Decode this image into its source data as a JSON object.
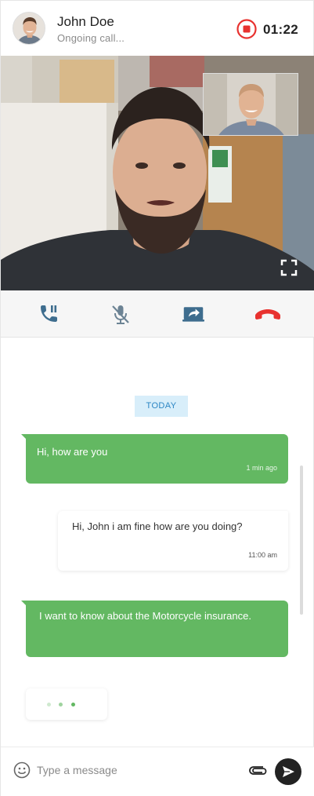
{
  "header": {
    "contact_name": "John Doe",
    "status": "Ongoing call...",
    "timer": "01:22",
    "record_icon": "record-stop-icon"
  },
  "video": {
    "fullscreen_icon": "fullscreen-icon"
  },
  "controls": {
    "items": [
      {
        "name": "hold-call",
        "icon": "phone-pause-icon"
      },
      {
        "name": "mute",
        "icon": "microphone-off-icon"
      },
      {
        "name": "share-screen",
        "icon": "screen-share-icon"
      },
      {
        "name": "end-call",
        "icon": "hang-up-icon"
      }
    ]
  },
  "chat": {
    "date_separator": "TODAY",
    "messages": [
      {
        "direction": "incoming",
        "text": "Hi, how are you",
        "time": "1 min ago"
      },
      {
        "direction": "outgoing",
        "text": "Hi, John i am fine how are you doing?",
        "time": "11:00 am"
      },
      {
        "direction": "incoming",
        "text": "I want to know about the Motorcycle insurance.",
        "time": ""
      }
    ],
    "typing_indicator": "typing-dots"
  },
  "composer": {
    "placeholder": "Type a message",
    "value": "",
    "emoji_icon": "emoji-icon",
    "attach_icon": "paperclip-icon",
    "send_icon": "send-icon"
  },
  "colors": {
    "incoming_bubble": "#63b862",
    "record_red": "#e8322f",
    "hangup_red": "#e8322f",
    "icon_blue": "#3e6d8e",
    "today_bg": "#d8eefa",
    "today_text": "#2c86c4"
  }
}
